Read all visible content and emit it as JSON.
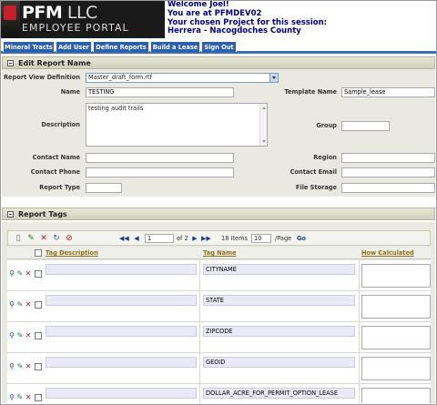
{
  "header": {
    "logo_main": "PFM",
    "logo_llc": " LLC",
    "logo_sub": "EMPLOYEE PORTAL",
    "welcome_line1": "Welcome Joel!",
    "welcome_line2": "You are at PFMDEV02",
    "welcome_line3": "Your chosen Project for this session:",
    "welcome_line4": "Herrera - Nacogdoches County"
  },
  "nav": {
    "tabs": [
      "Mineral Tracts",
      "Add User",
      "Define Reports",
      "Build a Lease",
      "Sign Out"
    ]
  },
  "edit_section": {
    "title": "Edit Report Name",
    "labels": {
      "report_view_definition": "Report View Definition",
      "name": "Name",
      "template_name": "Template Name",
      "description": "Description",
      "group": "Group",
      "contact_name": "Contact Name",
      "region": "Region",
      "contact_phone": "Contact Phone",
      "contact_email": "Contact Email",
      "report_type": "Report Type",
      "file_storage": "File Storage"
    },
    "values": {
      "report_view_definition": "Master_draft_form.rtf",
      "name": "TESTING",
      "template_name": "Sample_lease",
      "description": "testing audit trails",
      "group": "",
      "contact_name": "",
      "region": "",
      "contact_phone": "",
      "contact_email": "",
      "report_type": "",
      "file_storage": ""
    }
  },
  "tags_section": {
    "title": "Report Tags",
    "pager": {
      "page": "1",
      "of_text": "of 2",
      "items_text": "18 Items",
      "per_page": "10",
      "per_page_label": "/Page",
      "go": "Go"
    },
    "columns": [
      "Tag Description",
      "Tag Name",
      "How Calculated"
    ],
    "rows": [
      {
        "tag_description": "",
        "tag_name": "CITYNAME",
        "how_calculated": ""
      },
      {
        "tag_description": "",
        "tag_name": "STATE",
        "how_calculated": ""
      },
      {
        "tag_description": "",
        "tag_name": "ZIPCODE",
        "how_calculated": ""
      },
      {
        "tag_description": "",
        "tag_name": "GEOID",
        "how_calculated": ""
      },
      {
        "tag_description": "",
        "tag_name": "DOLLAR_ACRE_FOR_PERMIT_OPTION_LEASE",
        "how_calculated": ""
      }
    ]
  },
  "colors": {
    "nav_tab": "#2c5fb0",
    "nav_border": "#3b6eb6",
    "welcome_text": "#000080",
    "panel_bg": "#e9e9e2",
    "column_header": "#8c6e1a",
    "logo_red": "#c8202a"
  },
  "icons": {
    "toolbar": [
      "new-document-icon",
      "edit-icon",
      "delete-icon",
      "refresh-icon",
      "filter-icon"
    ],
    "pager": [
      "first-page-icon",
      "previous-page-icon",
      "next-page-icon",
      "last-page-icon"
    ],
    "row_actions": [
      "view-icon",
      "edit-icon",
      "delete-icon"
    ],
    "section_toggle": "collapse-icon"
  }
}
